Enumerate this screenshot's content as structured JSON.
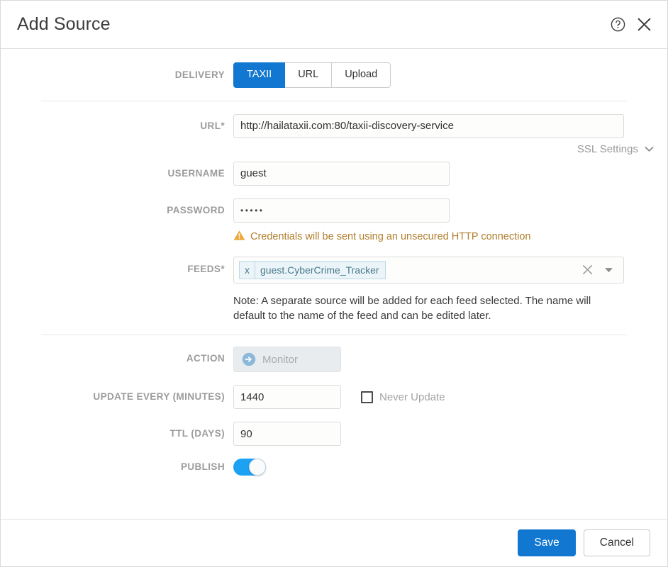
{
  "dialog": {
    "title": "Add Source",
    "help_icon": "question-circle-icon",
    "close_icon": "close-icon"
  },
  "delivery": {
    "label": "Delivery",
    "options": [
      "TAXII",
      "URL",
      "Upload"
    ],
    "selected": "TAXII",
    "active_color": "#1177d1"
  },
  "url_field": {
    "label": "URL*",
    "value": "http://hailataxii.com:80/taxii-discovery-service",
    "placeholder": ""
  },
  "ssl": {
    "label": "SSL Settings",
    "caret": "chevron-down-icon"
  },
  "username_field": {
    "label": "Username",
    "value": "guest",
    "placeholder": ""
  },
  "password_field": {
    "label": "Password",
    "value": "•••••",
    "masked_length": 5,
    "placeholder": ""
  },
  "warning": {
    "icon": "warning-triangle-icon",
    "text": "Credentials will be sent using an unsecured HTTP connection",
    "color": "#b07f2c"
  },
  "feeds_field": {
    "label": "Feeds*",
    "chips": [
      {
        "remove_icon": "x",
        "label": "guest.CyberCrime_Tracker"
      }
    ],
    "clear_icon": "clear-all-icon",
    "caret_icon": "dropdown-caret-icon",
    "note": "Note: A separate source will be added for each feed selected. The name will default to the name of the feed and can be edited later."
  },
  "action_field": {
    "label": "Action",
    "value": "Monitor",
    "icon": "arrow-right-circle-icon",
    "icon_color": "#8cb9d9"
  },
  "update_field": {
    "label": "Update Every (Minutes)",
    "value": "1440",
    "placeholder": "",
    "never_update_label": "Never Update",
    "never_update_checked": false
  },
  "ttl_field": {
    "label": "TTL (Days)",
    "value": "90",
    "placeholder": ""
  },
  "publish_field": {
    "label": "Publish",
    "enabled": true,
    "on_color": "#1da1f2"
  },
  "footer": {
    "save_label": "Save",
    "cancel_label": "Cancel"
  }
}
